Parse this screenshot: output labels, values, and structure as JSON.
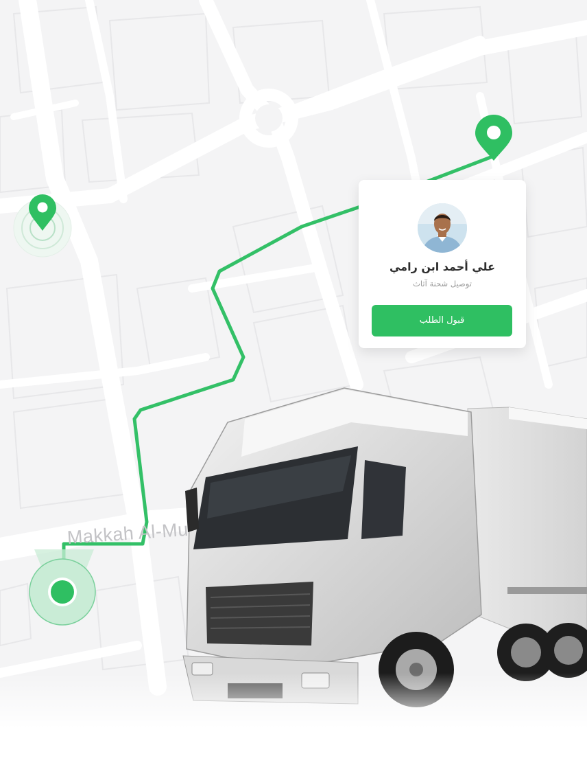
{
  "map": {
    "street_label": "Makkah Al-Mukarramah"
  },
  "driver_card": {
    "name": "علي أحمد ابن رامي",
    "service": "توصيل شحنة آثاث",
    "accept_label": "قبول الطلب"
  },
  "colors": {
    "accent": "#2fbf62",
    "map_background": "#f4f4f5",
    "road": "#ffffff",
    "card": "#ffffff"
  },
  "icons": {
    "destination": "map-pin-icon",
    "waypoint": "map-pin-icon",
    "origin": "current-location-icon"
  }
}
